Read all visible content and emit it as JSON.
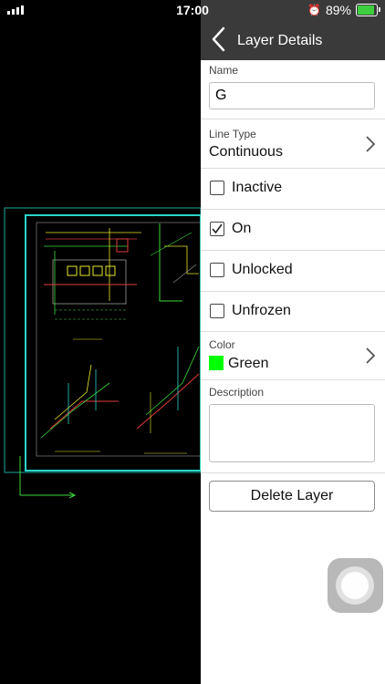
{
  "status_bar": {
    "time": "17:00",
    "battery_percent": "89%",
    "battery_level": 0.89
  },
  "panel": {
    "title": "Layer Details",
    "name": {
      "label": "Name",
      "value": "G"
    },
    "line_type": {
      "label": "Line Type",
      "value": "Continuous"
    },
    "toggles": [
      {
        "label": "Inactive",
        "checked": false
      },
      {
        "label": "On",
        "checked": true
      },
      {
        "label": "Unlocked",
        "checked": false
      },
      {
        "label": "Unfrozen",
        "checked": false
      }
    ],
    "color": {
      "label": "Color",
      "value": "Green",
      "hex": "#00ff00"
    },
    "description": {
      "label": "Description",
      "value": ""
    },
    "delete_label": "Delete Layer"
  },
  "colors": {
    "header_bg": "#3a3a3a",
    "cad_frame": "#2ad4c8",
    "cad_green": "#3ddc3d",
    "cad_yellow": "#e6e62a",
    "cad_red": "#e23b3b"
  }
}
